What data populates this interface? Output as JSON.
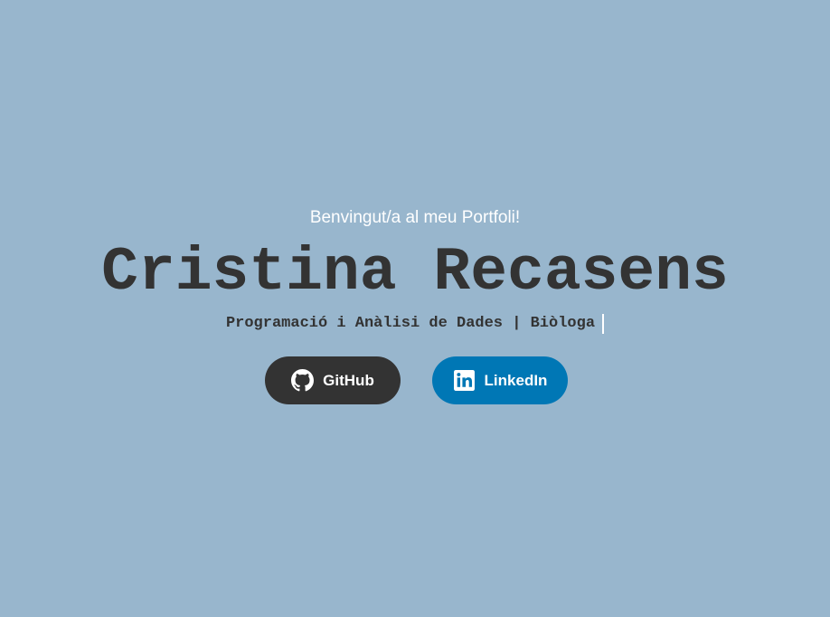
{
  "hero": {
    "welcome": "Benvingut/a al meu Portfoli!",
    "name": "Cristina Recasens",
    "subtitle": "Programació i Anàlisi de Dades | Biòloga"
  },
  "buttons": {
    "github": {
      "label": "GitHub",
      "icon": "github-icon"
    },
    "linkedin": {
      "label": "LinkedIn",
      "icon": "linkedin-icon"
    }
  },
  "colors": {
    "background": "#98b6cd",
    "github_button": "#333333",
    "linkedin_button": "#0077b5",
    "name_text": "#333333"
  }
}
